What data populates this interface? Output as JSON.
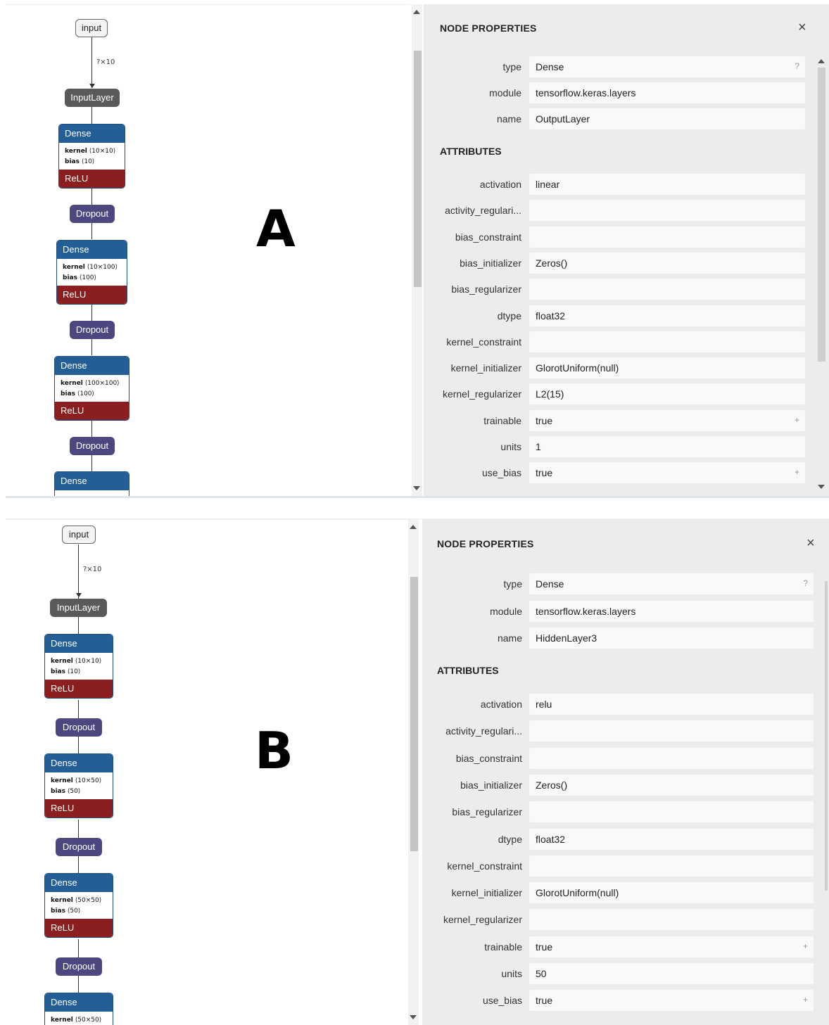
{
  "panel_a": {
    "label": "A",
    "graph": {
      "input": "input",
      "edge_label": "?×10",
      "input_layer": "InputLayer",
      "dense_blocks": [
        {
          "title": "Dense",
          "kernel_label": "kernel",
          "kernel_shape": "⟨10×10⟩",
          "bias_label": "bias",
          "bias_shape": "⟨10⟩",
          "activation": "ReLU"
        },
        {
          "title": "Dense",
          "kernel_label": "kernel",
          "kernel_shape": "⟨10×100⟩",
          "bias_label": "bias",
          "bias_shape": "⟨100⟩",
          "activation": "ReLU"
        },
        {
          "title": "Dense",
          "kernel_label": "kernel",
          "kernel_shape": "⟨100×100⟩",
          "bias_label": "bias",
          "bias_shape": "⟨100⟩",
          "activation": "ReLU"
        }
      ],
      "dropouts": [
        "Dropout",
        "Dropout",
        "Dropout"
      ],
      "last_dense_title": "Dense"
    },
    "properties": {
      "title": "NODE PROPERTIES",
      "close_icon": "×",
      "node_rows": [
        {
          "label": "type",
          "value": "Dense",
          "glyph": "?"
        },
        {
          "label": "module",
          "value": "tensorflow.keras.layers",
          "glyph": ""
        },
        {
          "label": "name",
          "value": "OutputLayer",
          "glyph": ""
        }
      ],
      "attributes_title": "ATTRIBUTES",
      "attribute_rows": [
        {
          "label": "activation",
          "value": "linear",
          "glyph": ""
        },
        {
          "label": "activity_regulari...",
          "value": "",
          "glyph": ""
        },
        {
          "label": "bias_constraint",
          "value": "",
          "glyph": ""
        },
        {
          "label": "bias_initializer",
          "value": "Zeros()",
          "glyph": ""
        },
        {
          "label": "bias_regularizer",
          "value": "",
          "glyph": ""
        },
        {
          "label": "dtype",
          "value": "float32",
          "glyph": ""
        },
        {
          "label": "kernel_constraint",
          "value": "",
          "glyph": ""
        },
        {
          "label": "kernel_initializer",
          "value": "GlorotUniform(null)",
          "glyph": ""
        },
        {
          "label": "kernel_regularizer",
          "value": "L2(15)",
          "glyph": ""
        },
        {
          "label": "trainable",
          "value": "true",
          "glyph": "+"
        },
        {
          "label": "units",
          "value": "1",
          "glyph": ""
        },
        {
          "label": "use_bias",
          "value": "true",
          "glyph": "+"
        }
      ]
    }
  },
  "panel_b": {
    "label": "B",
    "graph": {
      "input": "input",
      "edge_label": "?×10",
      "input_layer": "InputLayer",
      "dense_blocks": [
        {
          "title": "Dense",
          "kernel_label": "kernel",
          "kernel_shape": "⟨10×10⟩",
          "bias_label": "bias",
          "bias_shape": "⟨10⟩",
          "activation": "ReLU"
        },
        {
          "title": "Dense",
          "kernel_label": "kernel",
          "kernel_shape": "⟨10×50⟩",
          "bias_label": "bias",
          "bias_shape": "⟨50⟩",
          "activation": "ReLU"
        },
        {
          "title": "Dense",
          "kernel_label": "kernel",
          "kernel_shape": "⟨50×50⟩",
          "bias_label": "bias",
          "bias_shape": "⟨50⟩",
          "activation": "ReLU"
        }
      ],
      "dropouts": [
        "Dropout",
        "Dropout",
        "Dropout"
      ],
      "last_dense_title": "Dense",
      "last_dense_kernel_label": "kernel",
      "last_dense_kernel_shape": "⟨50×50⟩"
    },
    "properties": {
      "title": "NODE PROPERTIES",
      "close_icon": "×",
      "node_rows": [
        {
          "label": "type",
          "value": "Dense",
          "glyph": "?"
        },
        {
          "label": "module",
          "value": "tensorflow.keras.layers",
          "glyph": ""
        },
        {
          "label": "name",
          "value": "HiddenLayer3",
          "glyph": ""
        }
      ],
      "attributes_title": "ATTRIBUTES",
      "attribute_rows": [
        {
          "label": "activation",
          "value": "relu",
          "glyph": ""
        },
        {
          "label": "activity_regulari...",
          "value": "",
          "glyph": ""
        },
        {
          "label": "bias_constraint",
          "value": "",
          "glyph": ""
        },
        {
          "label": "bias_initializer",
          "value": "Zeros()",
          "glyph": ""
        },
        {
          "label": "bias_regularizer",
          "value": "",
          "glyph": ""
        },
        {
          "label": "dtype",
          "value": "float32",
          "glyph": ""
        },
        {
          "label": "kernel_constraint",
          "value": "",
          "glyph": ""
        },
        {
          "label": "kernel_initializer",
          "value": "GlorotUniform(null)",
          "glyph": ""
        },
        {
          "label": "kernel_regularizer",
          "value": "",
          "glyph": ""
        },
        {
          "label": "trainable",
          "value": "true",
          "glyph": "+"
        },
        {
          "label": "units",
          "value": "50",
          "glyph": ""
        },
        {
          "label": "use_bias",
          "value": "true",
          "glyph": "+"
        }
      ]
    }
  }
}
